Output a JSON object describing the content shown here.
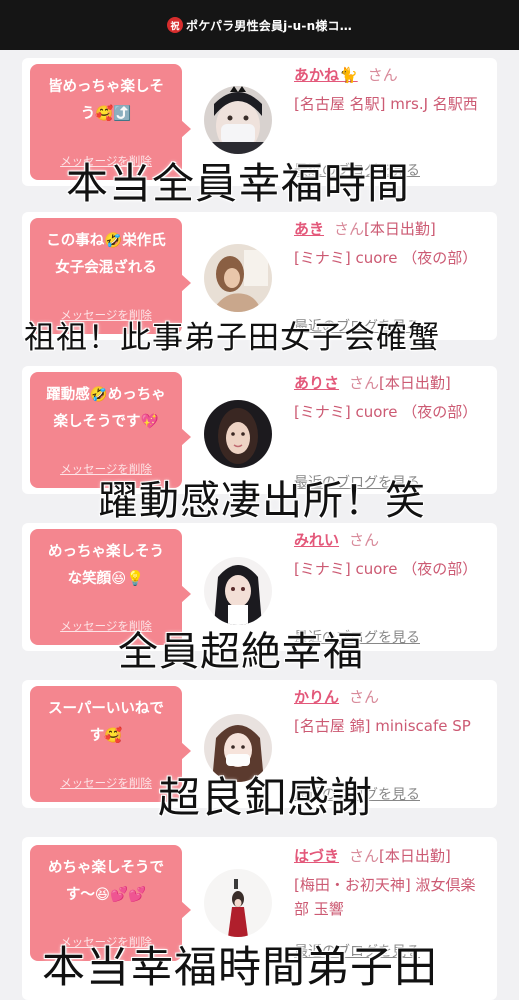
{
  "topbar": {
    "badge": "祝",
    "title": "ポケパラ男性会員j-u-n様コ…"
  },
  "common": {
    "delete_label": "メッセージを削除",
    "blog_label": "最近のブログを見る",
    "san": "さん"
  },
  "cards": [
    {
      "message": "皆めっちゃ楽しそう🥰⤴️",
      "message_parts": [
        "皆めっちゃ楽しそ",
        "う🥰⤴️"
      ],
      "name": "あかね🐈",
      "status": "",
      "shop": "[名古屋 名駅] mrs.J 名駅西",
      "overlay": "本当全員幸福時間"
    },
    {
      "message": "この事ね🤣栄作氏女子会混ざれる",
      "message_parts": [
        "この事ね🤣栄作氏",
        "女子会混ざれる"
      ],
      "name": "あき",
      "status": "[本日出勤]",
      "shop": "[ミナミ] cuore （夜の部）",
      "overlay": "祖祖！此事弟子田女子会確蟹"
    },
    {
      "message": "躍動感🤣めっちゃ楽しそうです💖",
      "message_parts": [
        "躍動感🤣めっちゃ",
        "楽しそうです💖"
      ],
      "name": "ありさ",
      "status": "[本日出勤]",
      "shop": "[ミナミ] cuore （夜の部）",
      "overlay": "躍動感凄出所！笑"
    },
    {
      "message": "めっちゃ楽しそうな笑顔😆💡",
      "message_parts": [
        "めっちゃ楽しそう",
        "な笑顔😆💡"
      ],
      "name": "みれい",
      "status": "",
      "shop": "[ミナミ] cuore （夜の部）",
      "overlay": "全員超絶幸福"
    },
    {
      "message": "スーパーいいねです🥰",
      "message_parts": [
        "スーパーいいねで",
        "す🥰"
      ],
      "name": "かりん",
      "status": "",
      "shop": "[名古屋 錦] miniscafe SP",
      "overlay": "超良釦感謝"
    },
    {
      "message": "めちゃ楽しそうです〜😆💕💕",
      "message_parts": [
        "めちゃ楽しそうで",
        "す〜😆💕💕"
      ],
      "name": "はづき",
      "status": "[本日出勤]",
      "shop": "[梅田・お初天神] 淑女倶楽部 玉響",
      "overlay": "本当幸福時間弟子田"
    }
  ],
  "colors": {
    "bubble": "#f4868f",
    "name": "#e3587a",
    "shop": "#cc5a73",
    "topbar": "#151515",
    "background": "#f1f1f3"
  }
}
